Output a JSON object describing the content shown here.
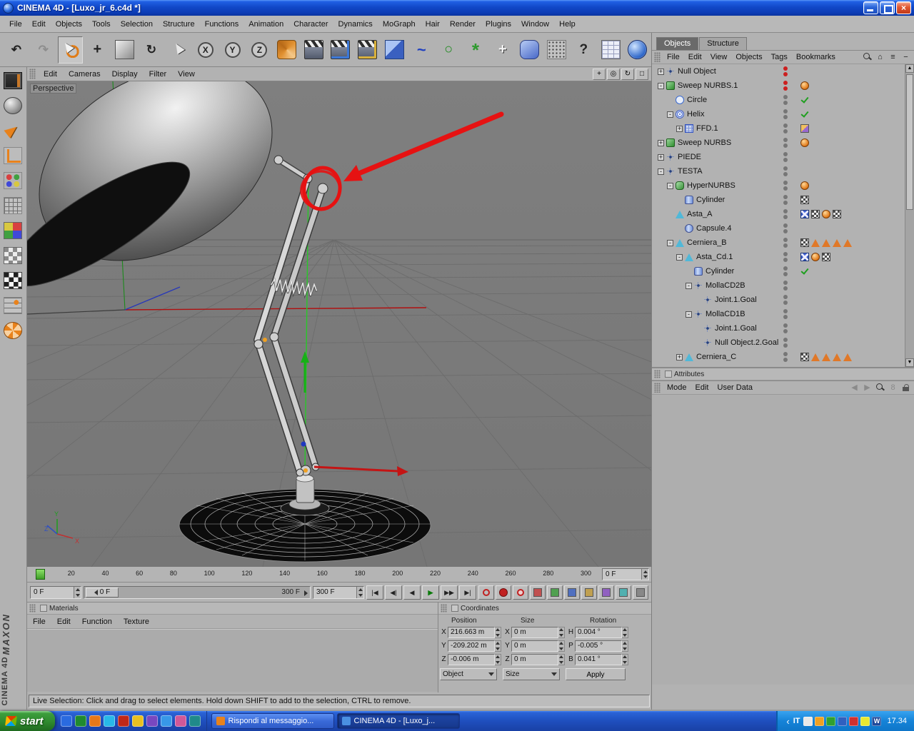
{
  "window": {
    "title": "CINEMA 4D - [Luxo_jr_6.c4d *]",
    "close_glyph": "×"
  },
  "menubar": [
    "File",
    "Edit",
    "Objects",
    "Tools",
    "Selection",
    "Structure",
    "Functions",
    "Animation",
    "Character",
    "Dynamics",
    "MoGraph",
    "Hair",
    "Render",
    "Plugins",
    "Window",
    "Help"
  ],
  "toolbar": [
    {
      "name": "undo-button",
      "glyph": "↶",
      "cls": "g",
      "state": ""
    },
    {
      "name": "redo-button",
      "glyph": "↷",
      "cls": "g dim",
      "state": ""
    },
    {
      "name": "live-selection-button",
      "glyph": "",
      "cls": "cursor",
      "state": "pressed"
    },
    {
      "name": "move-tool-button",
      "glyph": "+",
      "cls": "g big",
      "state": ""
    },
    {
      "name": "scale-tool-button",
      "glyph": "",
      "cls": "scale",
      "state": ""
    },
    {
      "name": "rotate-tool-button",
      "glyph": "↻",
      "cls": "g",
      "state": ""
    },
    {
      "name": "selection-tool-button",
      "glyph": "",
      "cls": "cursor2",
      "state": ""
    },
    {
      "name": "x-axis-lock-button",
      "glyph": "X",
      "cls": "axis",
      "state": ""
    },
    {
      "name": "y-axis-lock-button",
      "glyph": "Y",
      "cls": "axis",
      "state": ""
    },
    {
      "name": "z-axis-lock-button",
      "glyph": "Z",
      "cls": "axis",
      "state": ""
    },
    {
      "name": "coordinate-system-button",
      "glyph": "",
      "cls": "coord",
      "state": ""
    },
    {
      "name": "render-view-button",
      "glyph": "",
      "cls": "clapper",
      "state": ""
    },
    {
      "name": "render-picture-viewer-button",
      "glyph": "",
      "cls": "clapper c2",
      "state": ""
    },
    {
      "name": "render-settings-button",
      "glyph": "",
      "cls": "clapper c3",
      "state": ""
    },
    {
      "name": "add-primitive-button",
      "glyph": "",
      "cls": "cube",
      "state": ""
    },
    {
      "name": "add-spline-button",
      "glyph": "~",
      "cls": "spline",
      "state": ""
    },
    {
      "name": "add-nurbs-button",
      "glyph": "○",
      "cls": "nurbs",
      "state": ""
    },
    {
      "name": "add-modeling-button",
      "glyph": "*",
      "cls": "flower",
      "state": ""
    },
    {
      "name": "add-expression-button",
      "glyph": "+",
      "cls": "big white",
      "state": ""
    },
    {
      "name": "add-deformer-button",
      "glyph": "",
      "cls": "deformer",
      "state": ""
    },
    {
      "name": "add-particles-button",
      "glyph": "",
      "cls": "particles",
      "state": ""
    },
    {
      "name": "help-button",
      "glyph": "?",
      "cls": "help",
      "state": ""
    },
    {
      "name": "content-browser-button",
      "glyph": "",
      "cls": "browser",
      "state": ""
    },
    {
      "name": "online-updater-button",
      "glyph": "",
      "cls": "globe",
      "state": ""
    }
  ],
  "left_toolbar": [
    {
      "name": "layout-manager-icon",
      "cls": "lt-layout"
    },
    {
      "name": "shader-ball-icon",
      "cls": "lt-sphere"
    },
    {
      "name": "move-tool-icon",
      "cls": "lt-arrow"
    },
    {
      "name": "axis-tool-icon",
      "cls": "lt-axes"
    },
    {
      "name": "array-tool-icon",
      "cls": "lt-array"
    },
    {
      "name": "grid-tool-icon",
      "cls": "lt-grid"
    },
    {
      "name": "color-palette-icon",
      "cls": "lt-colors"
    },
    {
      "name": "texture-view-icon",
      "cls": "lt-texture"
    },
    {
      "name": "checker-view-icon",
      "cls": "lt-checker"
    },
    {
      "name": "snap-tool-icon",
      "cls": "lt-snap"
    },
    {
      "name": "selection-wheel-icon",
      "cls": "lt-flower"
    }
  ],
  "viewport": {
    "label": "Perspective",
    "menu": [
      "Edit",
      "Cameras",
      "Display",
      "Filter",
      "View"
    ],
    "view_buttons": [
      {
        "name": "pan-view-button",
        "glyph": "+"
      },
      {
        "name": "zoom-view-button",
        "glyph": "◎"
      },
      {
        "name": "rotate-view-button",
        "glyph": "↻"
      },
      {
        "name": "toggle-view-button",
        "glyph": "□"
      }
    ],
    "axis": {
      "x": "X",
      "y": "Y",
      "z": "Z"
    }
  },
  "object_manager": {
    "tabs": [
      {
        "label": "Objects",
        "state": "active"
      },
      {
        "label": "Structure",
        "state": "normal"
      }
    ],
    "menu": [
      "File",
      "Edit",
      "View",
      "Objects",
      "Tags",
      "Bookmarks"
    ],
    "icons": [
      {
        "name": "search-icon",
        "glyph": "",
        "cls": "i-search"
      },
      {
        "name": "home-icon",
        "glyph": "⌂",
        "cls": ""
      },
      {
        "name": "filter-icon",
        "glyph": "≡",
        "cls": ""
      },
      {
        "name": "collapse-icon",
        "glyph": "−",
        "cls": ""
      }
    ],
    "tree": [
      {
        "label": "Null Object",
        "indent": 4,
        "exp": "+",
        "icon": "null",
        "dots": "red",
        "tags": []
      },
      {
        "label": "Sweep NURBS.1",
        "indent": 4,
        "exp": "-",
        "icon": "sweep",
        "dots": "red",
        "tags": [
          "phong"
        ]
      },
      {
        "label": "Circle",
        "indent": 17,
        "exp": "",
        "icon": "circle",
        "dots": "gray",
        "tags": [
          "check"
        ]
      },
      {
        "label": "Helix",
        "indent": 17,
        "exp": "-",
        "icon": "helix",
        "dots": "gray",
        "tags": [
          "check"
        ]
      },
      {
        "label": "FFD.1",
        "indent": 30,
        "exp": "+",
        "icon": "ffd",
        "dots": "gray",
        "tags": [
          "ffdtag"
        ]
      },
      {
        "label": "Sweep NURBS",
        "indent": 4,
        "exp": "+",
        "icon": "sweep",
        "dots": "gray",
        "tags": [
          "phong"
        ]
      },
      {
        "label": "PIEDE",
        "indent": 4,
        "exp": "+",
        "icon": "null",
        "dots": "gray",
        "tags": []
      },
      {
        "label": "TESTA",
        "indent": 4,
        "exp": "-",
        "icon": "null",
        "dots": "gray",
        "tags": []
      },
      {
        "label": "HyperNURBS",
        "indent": 17,
        "exp": "-",
        "icon": "hnurbs",
        "dots": "gray",
        "tags": [
          "phong"
        ]
      },
      {
        "label": "Cylinder",
        "indent": 30,
        "exp": "",
        "icon": "cylinder",
        "dots": "gray",
        "tags": [
          "texture"
        ]
      },
      {
        "label": "Asta_A",
        "indent": 17,
        "exp": "",
        "icon": "bone",
        "dots": "gray",
        "tags": [
          "xpresso",
          "texture",
          "phong",
          "texture"
        ]
      },
      {
        "label": "Capsule.4",
        "indent": 30,
        "exp": "",
        "icon": "capsule",
        "dots": "gray",
        "tags": []
      },
      {
        "label": "Cerniera_B",
        "indent": 17,
        "exp": "-",
        "icon": "bone",
        "dots": "gray",
        "tags": [
          "texture",
          "ik",
          "ik",
          "ik",
          "ik"
        ]
      },
      {
        "label": "Asta_Cd.1",
        "indent": 30,
        "exp": "-",
        "icon": "bone",
        "dots": "gray",
        "tags": [
          "xpresso",
          "phong",
          "texture"
        ]
      },
      {
        "label": "Cylinder",
        "indent": 43,
        "exp": "",
        "icon": "cylinder",
        "dots": "gray",
        "tags": [
          "check"
        ]
      },
      {
        "label": "MollaCD2B",
        "indent": 43,
        "exp": "-",
        "icon": "null",
        "dots": "gray",
        "tags": []
      },
      {
        "label": "Joint.1.Goal",
        "indent": 56,
        "exp": "",
        "icon": "null",
        "dots": "gray",
        "tags": []
      },
      {
        "label": "MollaCD1B",
        "indent": 43,
        "exp": "-",
        "icon": "null",
        "dots": "gray",
        "tags": []
      },
      {
        "label": "Joint.1.Goal",
        "indent": 56,
        "exp": "",
        "icon": "null",
        "dots": "gray",
        "tags": []
      },
      {
        "label": "Null Object.2.Goal",
        "indent": 56,
        "exp": "",
        "icon": "null",
        "dots": "gray",
        "tags": []
      },
      {
        "label": "Cerniera_C",
        "indent": 30,
        "exp": "+",
        "icon": "bone",
        "dots": "gray",
        "tags": [
          "texture",
          "ik",
          "ik",
          "ik",
          "ik"
        ]
      }
    ]
  },
  "attributes": {
    "title": "Attributes",
    "menu": [
      "Mode",
      "Edit",
      "User Data"
    ],
    "icons": [
      {
        "name": "back-icon",
        "glyph": "◀",
        "cls": "dim"
      },
      {
        "name": "forward-icon",
        "glyph": "▶",
        "cls": "dim"
      },
      {
        "name": "search-icon",
        "glyph": "",
        "cls": "i-search"
      },
      {
        "name": "history-icon",
        "glyph": "8",
        "cls": "dim"
      },
      {
        "name": "lock-icon",
        "glyph": "",
        "cls": "i-lock"
      }
    ]
  },
  "timeline": {
    "ruler": [
      "0",
      "20",
      "40",
      "60",
      "80",
      "100",
      "120",
      "140",
      "160",
      "180",
      "200",
      "220",
      "240",
      "260",
      "280",
      "300"
    ],
    "current": "0 F"
  },
  "transport": {
    "frame": "0 F",
    "range_start": "0 F",
    "range_end": "300 F",
    "end": "300 F",
    "nav": [
      {
        "name": "goto-start-button",
        "glyph": "|◀",
        "cls": ""
      },
      {
        "name": "previous-key-button",
        "glyph": "◀|",
        "cls": ""
      },
      {
        "name": "previous-frame-button",
        "glyph": "◀",
        "cls": ""
      },
      {
        "name": "play-forward-button",
        "glyph": "▶",
        "cls": "play"
      },
      {
        "name": "next-frame-button",
        "glyph": "▶▶",
        "cls": ""
      },
      {
        "name": "goto-end-button",
        "glyph": "▶|",
        "cls": ""
      }
    ],
    "rec": [
      {
        "name": "record-keyframe-button",
        "cls": "rec-ring"
      },
      {
        "name": "autokey-button",
        "cls": "rec-fill"
      },
      {
        "name": "record-selection-button",
        "cls": "rec-dot"
      },
      {
        "name": "record-position-toggle",
        "cls": "tog a"
      },
      {
        "name": "record-scale-toggle",
        "cls": "tog b"
      },
      {
        "name": "record-rotation-toggle",
        "cls": "tog c"
      },
      {
        "name": "record-parameter-toggle",
        "cls": "tog d"
      },
      {
        "name": "record-pla-toggle",
        "cls": "tog e"
      },
      {
        "name": "playback-mode-button",
        "cls": "tog f"
      },
      {
        "name": "snap-settings-button",
        "cls": "tog g2"
      }
    ]
  },
  "materials": {
    "title": "Materials",
    "menu": [
      "File",
      "Edit",
      "Function",
      "Texture"
    ]
  },
  "coordinates": {
    "title": "Coordinates",
    "headers": [
      "Position",
      "Size",
      "Rotation"
    ],
    "rows": [
      {
        "pl": "X",
        "pv": "216.663 m",
        "sl": "X",
        "sv": "0 m",
        "rl": "H",
        "rv": "0.004 °"
      },
      {
        "pl": "Y",
        "pv": "-209.202 m",
        "sl": "Y",
        "sv": "0 m",
        "rl": "P",
        "rv": "-0.005 °"
      },
      {
        "pl": "Z",
        "pv": "-0.006 m",
        "sl": "Z",
        "sv": "0 m",
        "rl": "B",
        "rv": "0.041 °"
      }
    ],
    "selectors": [
      "Object",
      "Size"
    ],
    "apply": "Apply"
  },
  "status": {
    "text": "Live Selection: Click and drag to select elements. Hold down SHIFT to add to the selection, CTRL to remove."
  },
  "branding": {
    "line1": "MAXON",
    "line2": "CINEMA 4D"
  },
  "taskbar": {
    "start_label": "start",
    "quicklaunch": [
      "#2a6ae0",
      "#208a30",
      "#e87818",
      "#28b8e8",
      "#c02818",
      "#e8c020",
      "#7848c0",
      "#3898e8",
      "#d05898",
      "#208a8a"
    ],
    "tasks": [
      {
        "label": "Rispondi al messaggio...",
        "state": "normal",
        "icon": "#e8821c"
      },
      {
        "label": "CINEMA 4D - [Luxo_j...",
        "state": "active",
        "icon": "#4a90e2"
      }
    ],
    "tray": {
      "lang": "IT",
      "time": "17.34",
      "icons": [
        {
          "c": "#e8e8e8",
          "g": ""
        },
        {
          "c": "#f0a020",
          "g": ""
        },
        {
          "c": "#30a030",
          "g": ""
        },
        {
          "c": "#3060c0",
          "g": ""
        },
        {
          "c": "#d03030",
          "g": ""
        },
        {
          "c": "#e8e830",
          "g": ""
        },
        {
          "c": "#204a9c",
          "g": "W"
        }
      ]
    }
  }
}
